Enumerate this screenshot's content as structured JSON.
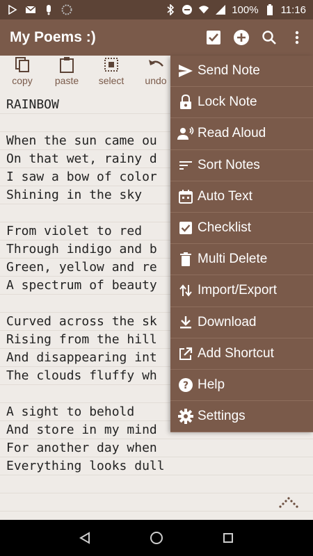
{
  "status_bar": {
    "battery": "100%",
    "time": "11:16",
    "icons": [
      "play-store-icon",
      "gmail-icon",
      "notification-icon",
      "sync-icon",
      "bluetooth-icon",
      "dnd-icon",
      "wifi-icon",
      "signal-icon",
      "battery-icon"
    ]
  },
  "app_bar": {
    "title": "My Poems :)",
    "actions": [
      "checkbox-icon",
      "add-icon",
      "search-icon",
      "overflow-menu-icon"
    ]
  },
  "toolbar": {
    "items": [
      {
        "label": "copy",
        "icon": "copy-icon"
      },
      {
        "label": "paste",
        "icon": "paste-icon"
      },
      {
        "label": "select",
        "icon": "select-icon"
      },
      {
        "label": "undo",
        "icon": "undo-icon"
      }
    ]
  },
  "note": {
    "lines": [
      "RAINBOW",
      "",
      "When the sun came ou",
      "On that wet, rainy d",
      "I saw a bow of color",
      "Shining in the sky",
      "",
      "From violet to red",
      "Through indigo and b",
      "Green, yellow and re",
      "A spectrum of beauty",
      "",
      "Curved across the sk",
      "Rising from the hill",
      "And disappearing int",
      "The clouds fluffy wh",
      "",
      "A sight to behold",
      "And store in my mind",
      "For another day when",
      "Everything looks dull",
      "",
      ""
    ]
  },
  "menu": {
    "items": [
      {
        "label": "Send Note",
        "icon": "send-icon"
      },
      {
        "label": "Lock Note",
        "icon": "lock-icon"
      },
      {
        "label": "Read Aloud",
        "icon": "read-aloud-icon"
      },
      {
        "label": "Sort Notes",
        "icon": "sort-icon"
      },
      {
        "label": "Auto Text",
        "icon": "auto-text-icon"
      },
      {
        "label": "Checklist",
        "icon": "checklist-icon"
      },
      {
        "label": "Multi Delete",
        "icon": "delete-icon"
      },
      {
        "label": "Import/Export",
        "icon": "import-export-icon"
      },
      {
        "label": "Download",
        "icon": "download-icon"
      },
      {
        "label": "Add Shortcut",
        "icon": "shortcut-icon"
      },
      {
        "label": "Help",
        "icon": "help-icon"
      },
      {
        "label": "Settings",
        "icon": "settings-icon"
      }
    ]
  },
  "colors": {
    "app_bar": "#7a5a4a",
    "status_bar": "#5c4336",
    "background": "#efebe7",
    "menu": "#7a5a4a"
  }
}
